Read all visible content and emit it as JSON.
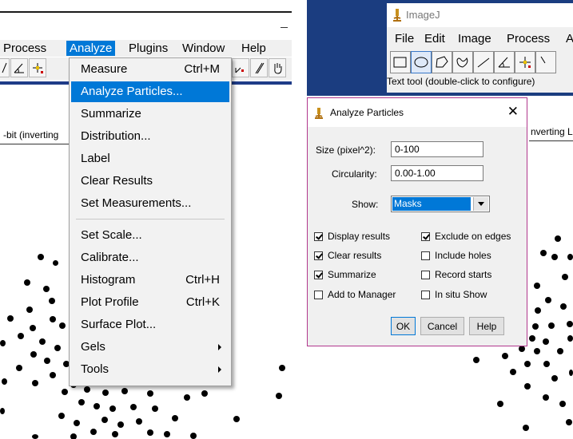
{
  "left": {
    "menubar": {
      "items": [
        {
          "label": "Process"
        },
        {
          "label": "Analyze"
        },
        {
          "label": "Plugins"
        },
        {
          "label": "Window"
        },
        {
          "label": "Help"
        }
      ]
    },
    "status_text": "-bit (inverting",
    "analyze_menu": {
      "items": [
        {
          "label": "Measure",
          "shortcut": "Ctrl+M"
        },
        {
          "label": "Analyze Particles..."
        },
        {
          "label": "Summarize"
        },
        {
          "label": "Distribution..."
        },
        {
          "label": "Label"
        },
        {
          "label": "Clear Results"
        },
        {
          "label": "Set Measurements..."
        },
        {
          "label": "Set Scale..."
        },
        {
          "label": "Calibrate..."
        },
        {
          "label": "Histogram",
          "shortcut": "Ctrl+H"
        },
        {
          "label": "Plot Profile",
          "shortcut": "Ctrl+K"
        },
        {
          "label": "Surface Plot..."
        },
        {
          "label": "Gels"
        },
        {
          "label": "Tools"
        }
      ]
    }
  },
  "right": {
    "imagej": {
      "title": "ImageJ",
      "menu": [
        "File",
        "Edit",
        "Image",
        "Process",
        "A"
      ],
      "hint": "Text tool (double-click to configure)"
    },
    "behind_label": "nverting L",
    "dialog": {
      "title": "Analyze Particles",
      "close": "✕",
      "size_label": "Size (pixel^2):",
      "size_value": "0-100",
      "circularity_label": "Circularity:",
      "circularity_value": "0.00-1.00",
      "show_label": "Show:",
      "show_value": "Masks",
      "checkboxes": [
        {
          "label": "Display results",
          "checked": true
        },
        {
          "label": "Exclude on edges",
          "checked": true
        },
        {
          "label": "Clear results",
          "checked": true
        },
        {
          "label": "Include holes",
          "checked": false
        },
        {
          "label": "Summarize",
          "checked": true
        },
        {
          "label": "Record starts",
          "checked": false
        },
        {
          "label": "Add to Manager",
          "checked": false
        },
        {
          "label": "In situ Show",
          "checked": false
        }
      ],
      "buttons": {
        "ok": "OK",
        "cancel": "Cancel",
        "help": "Help"
      }
    }
  },
  "colors": {
    "menu_highlight": "#0078d7",
    "toolbar_rule": "#1f3c88",
    "desktop": "#1b3d80",
    "dialog_border": "#b1378d"
  }
}
